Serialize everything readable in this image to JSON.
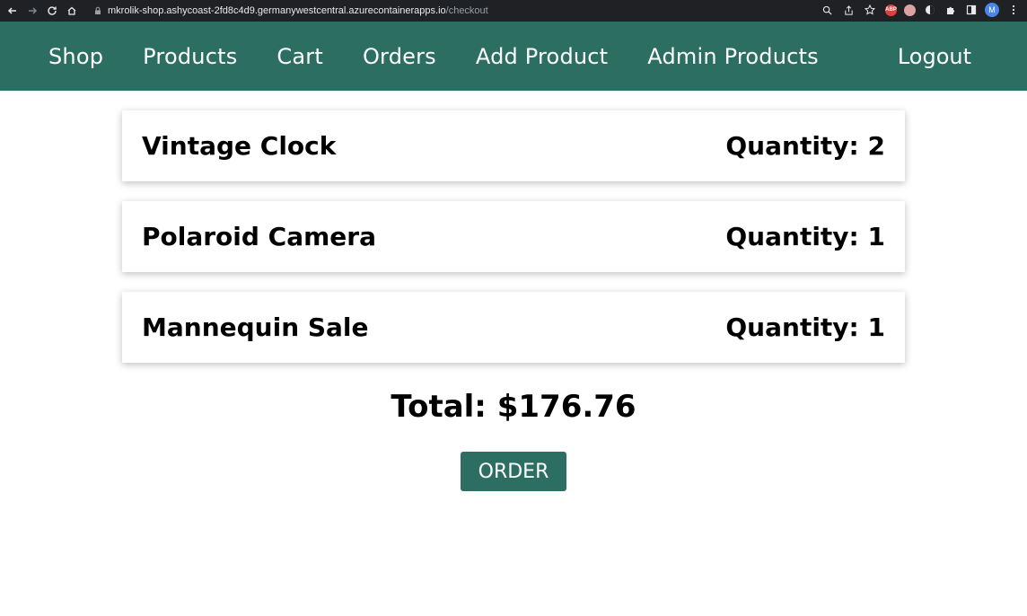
{
  "browser": {
    "url_host": "mkrolik-shop.ashycoast-2fd8c4d9.germanywestcentral.azurecontainerapps.io",
    "url_path": "/checkout",
    "profile_initial": "M",
    "abp_label": "ABP"
  },
  "nav": {
    "items": [
      {
        "label": "Shop"
      },
      {
        "label": "Products"
      },
      {
        "label": "Cart"
      },
      {
        "label": "Orders"
      },
      {
        "label": "Add Product"
      },
      {
        "label": "Admin Products"
      }
    ],
    "logout": "Logout"
  },
  "cart": {
    "items": [
      {
        "title": "Vintage Clock",
        "quantity_label": "Quantity: 2"
      },
      {
        "title": "Polaroid Camera",
        "quantity_label": "Quantity: 1"
      },
      {
        "title": "Mannequin Sale",
        "quantity_label": "Quantity: 1"
      }
    ],
    "total_label": "Total: $176.76",
    "order_button": "ORDER"
  },
  "colors": {
    "brand": "#2d6e63",
    "chrome": "#202124"
  }
}
